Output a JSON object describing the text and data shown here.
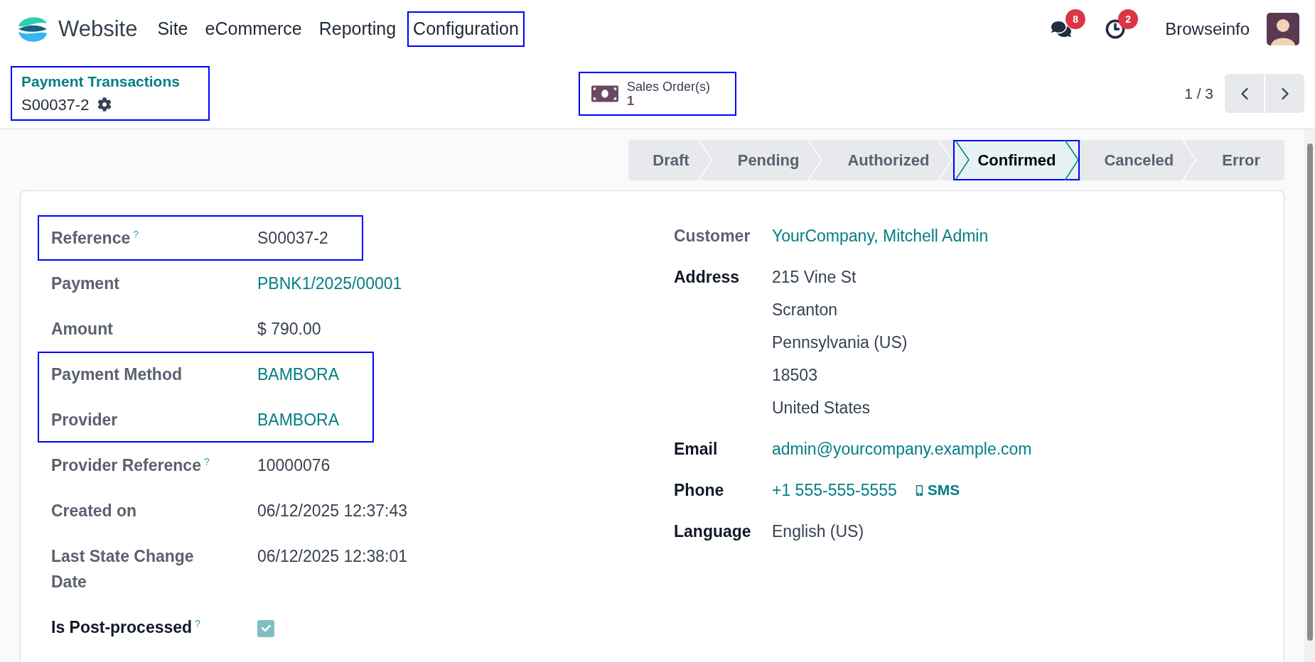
{
  "nav": {
    "app": "Website",
    "menu": [
      {
        "label": "Site",
        "highlighted": false
      },
      {
        "label": "eCommerce",
        "highlighted": false
      },
      {
        "label": "Reporting",
        "highlighted": false
      },
      {
        "label": "Configuration",
        "highlighted": true
      }
    ],
    "messages_badge": "8",
    "activities_badge": "2",
    "user": "Browseinfo"
  },
  "breadcrumb": {
    "parent": "Payment Transactions",
    "record": "S00037-2",
    "highlighted": true
  },
  "smart_button": {
    "label": "Sales Order(s)",
    "count": "1",
    "highlighted": true
  },
  "pager": "1 / 3",
  "statusbar": [
    {
      "label": "Draft",
      "selected": false,
      "highlighted": false
    },
    {
      "label": "Pending",
      "selected": false,
      "highlighted": false
    },
    {
      "label": "Authorized",
      "selected": false,
      "highlighted": false
    },
    {
      "label": "Confirmed",
      "selected": true,
      "highlighted": true
    },
    {
      "label": "Canceled",
      "selected": false,
      "highlighted": false
    },
    {
      "label": "Error",
      "selected": false,
      "highlighted": false
    }
  ],
  "left_groups": [
    {
      "highlighted": true,
      "fields": [
        {
          "label": "Reference",
          "kind": "text",
          "value": "S00037-2",
          "help": "?",
          "bold": false
        }
      ]
    },
    {
      "highlighted": false,
      "fields": [
        {
          "label": "Payment",
          "kind": "link",
          "value": "PBNK1/2025/00001",
          "bold": false
        },
        {
          "label": "Amount",
          "kind": "text",
          "value": "$ 790.00",
          "bold": false
        }
      ]
    },
    {
      "highlighted": true,
      "fields": [
        {
          "label": "Payment Method",
          "kind": "link",
          "value": "BAMBORA",
          "bold": false
        },
        {
          "label": "Provider",
          "kind": "link",
          "value": "BAMBORA",
          "bold": false
        }
      ]
    },
    {
      "highlighted": false,
      "fields": [
        {
          "label": "Provider Reference",
          "kind": "text",
          "value": "10000076",
          "help": "?",
          "bold": false
        },
        {
          "label": "Created on",
          "kind": "text",
          "value": "06/12/2025 12:37:43",
          "bold": false
        },
        {
          "label": "Last State Change Date",
          "kind": "text",
          "value": "06/12/2025 12:38:01",
          "bold": false
        },
        {
          "label": "Is Post-processed",
          "kind": "checkbox",
          "checked": true,
          "help": "?",
          "bold": true
        }
      ]
    }
  ],
  "right_fields": [
    {
      "label": "Customer",
      "kind": "link",
      "value": "YourCompany, Mitchell Admin",
      "bold": false
    },
    {
      "label": "Address",
      "kind": "lines",
      "lines": [
        "215 Vine St",
        "Scranton",
        "Pennsylvania (US)",
        "18503",
        "United States"
      ],
      "bold": true
    },
    {
      "label": "Email",
      "kind": "link",
      "value": "admin@yourcompany.example.com",
      "bold": true
    },
    {
      "label": "Phone",
      "kind": "phone",
      "value": "+1 555-555-5555",
      "sms": "SMS",
      "bold": true
    },
    {
      "label": "Language",
      "kind": "text",
      "value": "English (US)",
      "bold": true
    }
  ]
}
